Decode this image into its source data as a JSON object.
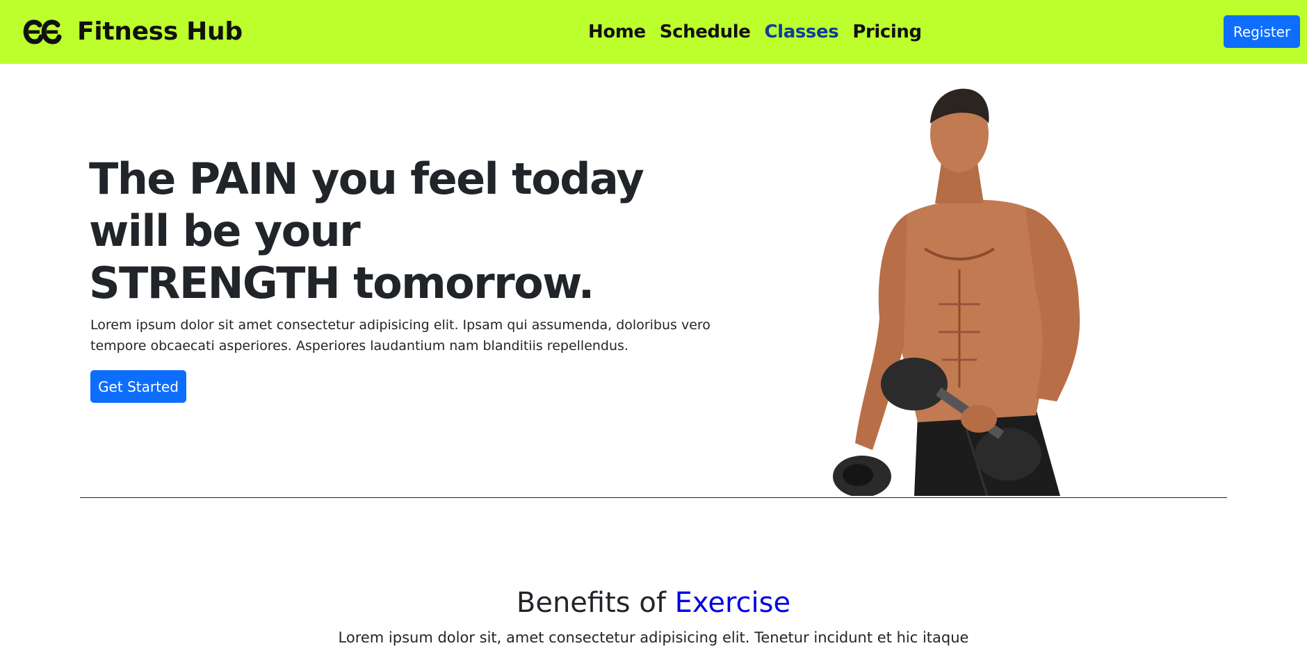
{
  "colors": {
    "navbar_bg": "#bcff2c",
    "primary_button": "#0d6efd",
    "active_nav": "#0d3d9f",
    "accent_text": "#0000e6"
  },
  "navbar": {
    "logo_icon": "double-c-logo-icon",
    "brand": "Fitness Hub",
    "links": [
      {
        "label": "Home",
        "active": false
      },
      {
        "label": "Schedule",
        "active": false
      },
      {
        "label": "Classes",
        "active": true
      },
      {
        "label": "Pricing",
        "active": false
      }
    ],
    "register_label": "Register"
  },
  "hero": {
    "title_lines": [
      "The PAIN you feel today",
      "will be your",
      "STRENGTH tomorrow."
    ],
    "text_lines": [
      "Lorem ipsum dolor sit amet consectetur adipisicing elit. Ipsam qui assumenda, doloribus vero",
      "tempore obcaecati asperiores. Asperiores laudantium nam blanditiis repellendus."
    ],
    "cta_label": "Get Started",
    "image": "bodybuilder-with-dumbbells"
  },
  "benefits": {
    "title_prefix": "Benefits of ",
    "title_accent": "Exercise",
    "text": "Lorem ipsum dolor sit, amet consectetur adipisicing elit. Tenetur incidunt et hic itaque"
  }
}
